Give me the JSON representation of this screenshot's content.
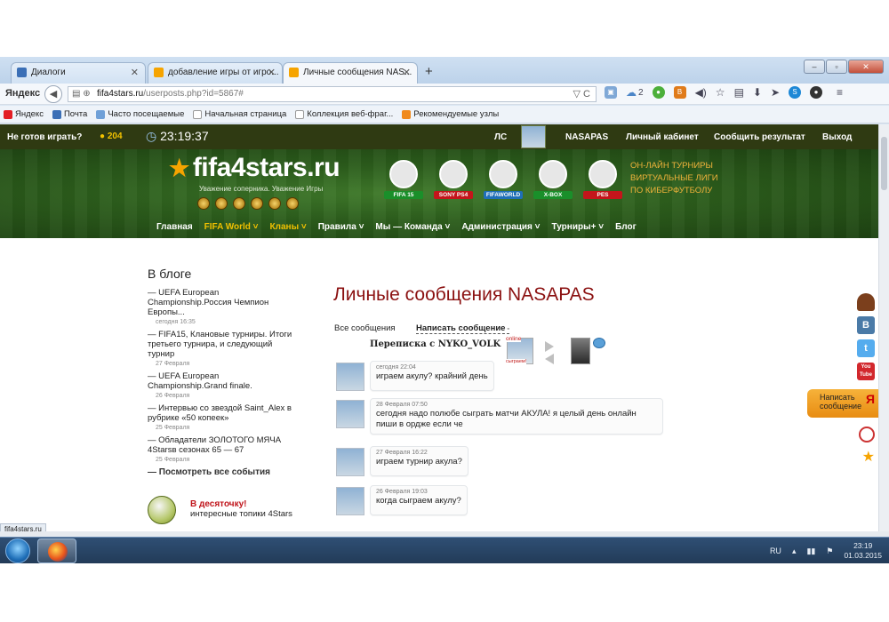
{
  "browser": {
    "tabs": [
      {
        "label": "Диалоги",
        "color": "#3b6fb6"
      },
      {
        "label": "добавление игры от игро...",
        "color": "#f6a400"
      },
      {
        "label": "Личные сообщения NAS...",
        "color": "#f6a400"
      }
    ],
    "brand": "Яндекс",
    "url_domain": "fifa4stars.ru",
    "url_path": "/userposts.php?id=5867#",
    "cloud_count": "2",
    "bookmarks": [
      "Яндекс",
      "Почта",
      "Часто посещаемые",
      "Начальная страница",
      "Коллекция веб-фраг...",
      "Рекомендуемые узлы"
    ],
    "status_url": "fifa4stars.ru"
  },
  "site": {
    "topbar": {
      "not_ready": "Не готов играть?",
      "coins": "204",
      "clock": "23:19:37",
      "ls": "ЛС",
      "username": "NASAPAS",
      "cabinet": "Личный кабинет",
      "report": "Сообщить результат",
      "logout": "Выход"
    },
    "logo": "fifa4stars.ru",
    "slogan": "Уважение соперника. Уважение Игры",
    "platforms": [
      {
        "label": "FIFA 15",
        "color": "#1a8f2a"
      },
      {
        "label": "SONY PS4",
        "color": "#c4151b"
      },
      {
        "label": "FIFAWORLD",
        "color": "#1f6fb8"
      },
      {
        "label": "X-BOX",
        "color": "#1a8f2a"
      },
      {
        "label": "PES",
        "color": "#c4151b"
      }
    ],
    "banner_lines": [
      "ОН-ЛАЙН ТУРНИРЫ",
      "ВИРТУАЛЬНЫЕ ЛИГИ",
      "ПО КИБЕРФУТБОЛУ"
    ],
    "nav": [
      "Главная",
      "FIFA World ˅",
      "Кланы ˅",
      "Правила ˅",
      "Мы — Команда ˅",
      "Администрация ˅",
      "Турниры+ ˅",
      "Блог"
    ]
  },
  "blog": {
    "title": "В блоге",
    "items": [
      {
        "text": "— UEFA European Championship.Россия Чемпион Европы...",
        "date": "сегодня 16:35"
      },
      {
        "text": "— FIFA15, Клановые турниры. Итоги третьего турнира, и следующий турнир",
        "date": "27 Февраля"
      },
      {
        "text": "— UEFA European Championship.Grand finale.",
        "date": "26 Февраля"
      },
      {
        "text": "— Интервью со звездой Saint_Alex в рубрике «50 копеек»",
        "date": "25 Февраля"
      },
      {
        "text": "— Обладатели ЗОЛОТОГО МЯЧА 4Starsв сезонах 65 — 67",
        "date": "25 Февраля"
      }
    ],
    "more": "— Посмотреть все события",
    "promo_title": "В десяточку!",
    "promo_text": "интересные топики 4Stars"
  },
  "messages": {
    "title": "Личные сообщения NASAPAS",
    "tab_all": "Все сообщения",
    "tab_write": "Написать сообщение",
    "conversation": "Переписка с NYKO_VOLK",
    "online": "online",
    "play_label": "сыграем!",
    "list": [
      {
        "date": "сегодня 22:04",
        "text": "играем акулу? крайний день"
      },
      {
        "date": "28 Февраля 07:50",
        "text": "сегодня надо полюбе сыграть матчи АКУЛА! я целый день онлайн пиши в ордже если че"
      },
      {
        "date": "27 Февраля 16:22",
        "text": "играем турнир акула?"
      },
      {
        "date": "26 Февраля 19:03",
        "text": "когда сыграем акулу?"
      }
    ]
  },
  "sidebar_widget": {
    "label": "Написать сообщение",
    "letter": "Я"
  },
  "social": [
    {
      "name": "vk",
      "glyph": "В",
      "color": "#4a7aa7"
    },
    {
      "name": "twitter",
      "glyph": "t",
      "color": "#55acee"
    },
    {
      "name": "youtube",
      "glyph": "You Tube",
      "color": "#d2282d"
    },
    {
      "name": "yandex",
      "glyph": "Я",
      "color": "#e31e24"
    }
  ],
  "taskbar": {
    "lang": "RU",
    "time": "23:19",
    "date": "01.03.2015"
  }
}
